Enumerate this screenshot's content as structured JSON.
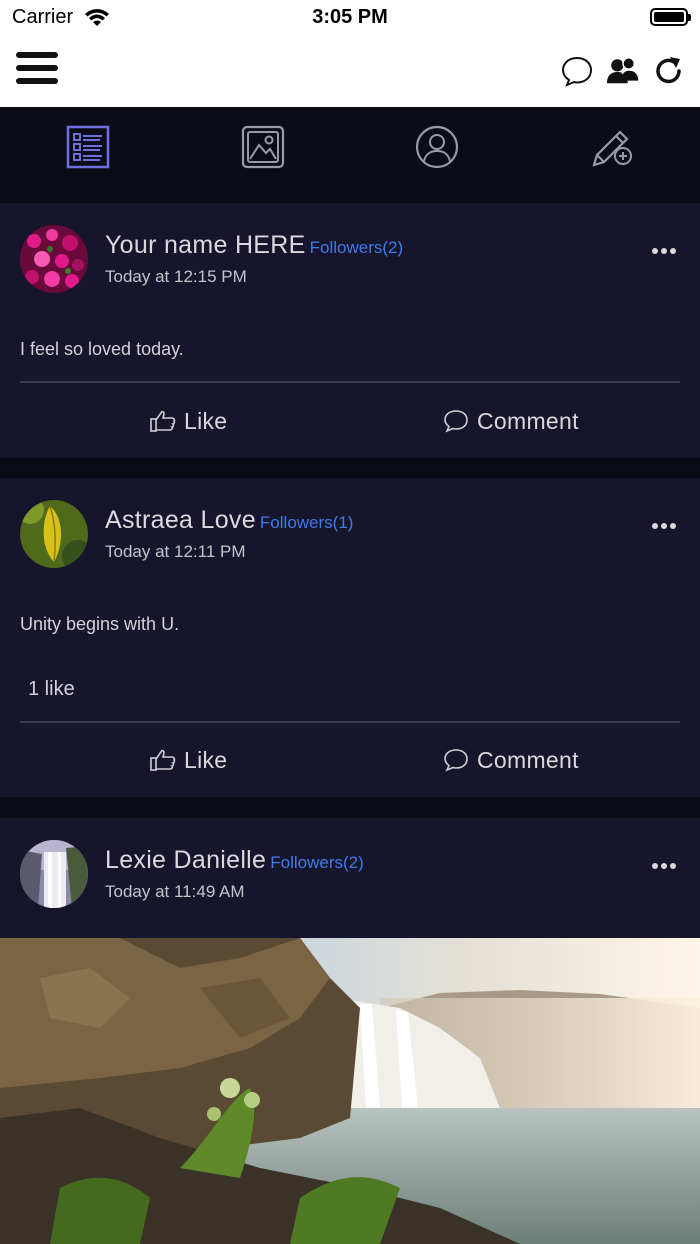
{
  "status_bar": {
    "carrier": "Carrier",
    "time": "3:05 PM"
  },
  "navbar": {
    "menu_icon": "hamburger-menu-icon",
    "right_icons": [
      "chat-bubble-icon",
      "friends-icon",
      "refresh-icon"
    ]
  },
  "tabs": [
    {
      "icon": "news-feed-icon",
      "active": true
    },
    {
      "icon": "gallery-icon",
      "active": false
    },
    {
      "icon": "profile-icon",
      "active": false
    },
    {
      "icon": "create-post-icon",
      "active": false
    }
  ],
  "colors": {
    "card_bg": "#16152c",
    "page_bg": "#0b0b18",
    "link_blue": "#3e7be8",
    "active_tab": "#6f6fe0"
  },
  "posts": [
    {
      "author": "Your name HERE",
      "followers": "Followers(2)",
      "timestamp": "Today at 12:15 PM",
      "text": "I feel so loved today.",
      "likes": "",
      "like_label": "Like",
      "comment_label": "Comment",
      "avatar": "pink-flowers-avatar"
    },
    {
      "author": "Astraea Love",
      "followers": "Followers(1)",
      "timestamp": "Today at 12:11 PM",
      "text": "Unity begins with U.",
      "likes": "1 like",
      "like_label": "Like",
      "comment_label": "Comment",
      "avatar": "leaf-avatar"
    },
    {
      "author": "Lexie Danielle",
      "followers": "Followers(2)",
      "timestamp": "Today at 11:49 AM",
      "text": "",
      "likes": "",
      "avatar": "waterfall-avatar",
      "image": "waterfall-photo"
    }
  ]
}
